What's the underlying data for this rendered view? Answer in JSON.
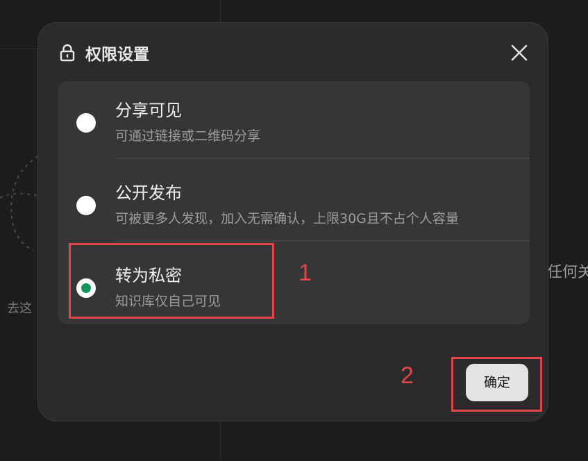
{
  "background": {
    "left_text": "去这",
    "right_text": "任何关"
  },
  "dialog": {
    "title": "权限设置",
    "header_icon": "lock-icon",
    "close_icon": "close-icon",
    "options": [
      {
        "title": "分享可见",
        "description": "可通过链接或二维码分享",
        "selected": false
      },
      {
        "title": "公开发布",
        "description": "可被更多人发现，加入无需确认，上限30G且不占个人容量",
        "selected": false
      },
      {
        "title": "转为私密",
        "description": "知识库仅自己可见",
        "selected": true
      }
    ],
    "confirm_label": "确定"
  },
  "annotations": {
    "label_1": "1",
    "label_2": "2"
  },
  "colors": {
    "selected_radio": "#13955a",
    "annotation": "#e0464b",
    "dialog_bg": "#2b2b2b",
    "panel_bg": "#363636"
  }
}
